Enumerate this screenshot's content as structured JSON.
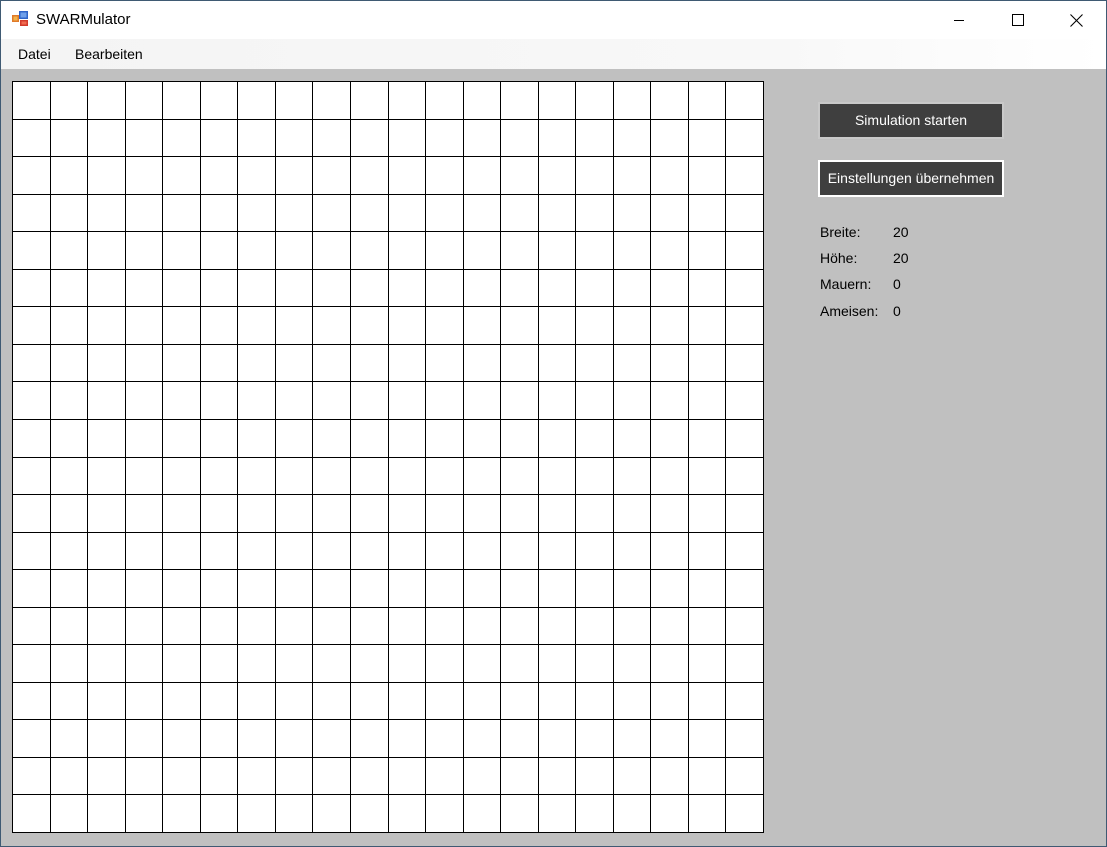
{
  "window": {
    "title": "SWARMulator"
  },
  "menu": {
    "items": [
      "Datei",
      "Bearbeiten"
    ]
  },
  "grid": {
    "columns": 20,
    "rows": 20
  },
  "controls": {
    "start_label": "Simulation starten",
    "apply_label": "Einstellungen übernehmen"
  },
  "stats": [
    {
      "label": "Breite:",
      "value": "20"
    },
    {
      "label": "Höhe:",
      "value": "20"
    },
    {
      "label": "Mauern:",
      "value": "0"
    },
    {
      "label": "Ameisen:",
      "value": "0"
    }
  ],
  "colors": {
    "workspace": "#c0c0c0",
    "button_bg": "#3f3f3f",
    "grid_line": "#000000",
    "cell": "#ffffff"
  },
  "icons": {
    "app": "app-logo-icon",
    "minimize": "minimize-icon",
    "maximize": "maximize-icon",
    "close": "close-icon"
  }
}
